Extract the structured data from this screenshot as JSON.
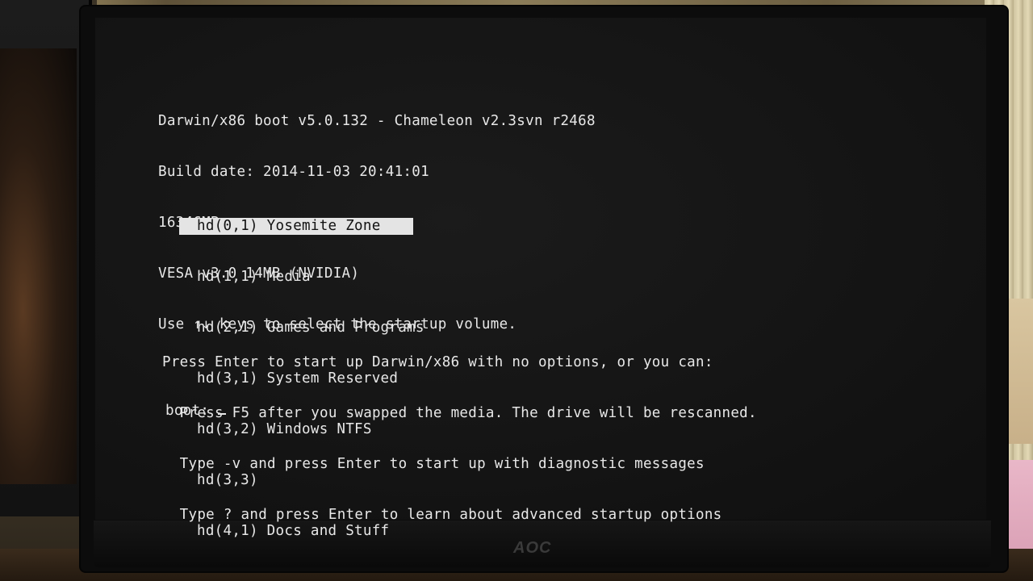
{
  "header": {
    "line1": "Darwin/x86 boot v5.0.132 - Chameleon v2.3svn r2468",
    "line2": "Build date: 2014-11-03 20:41:01",
    "line3": "16346MB memory",
    "line4": "VESA v3.0 14MB (NVIDIA)",
    "line5": "Use ↑↓ keys to select the startup volume."
  },
  "volumes": [
    {
      "label": "hd(0,1) Yosemite Zone",
      "selected": true
    },
    {
      "label": "hd(1,1) Media",
      "selected": false
    },
    {
      "label": "hd(2,1) Games and Programs",
      "selected": false
    },
    {
      "label": "hd(3,1) System Reserved",
      "selected": false
    },
    {
      "label": "hd(3,2) Windows NTFS",
      "selected": false
    },
    {
      "label": "hd(3,3)",
      "selected": false
    },
    {
      "label": "hd(4,1) Docs and Stuff",
      "selected": false
    }
  ],
  "help": {
    "line1": "Press Enter to start up Darwin/x86 with no options, or you can:",
    "line2": "  Press F5 after you swapped the media. The drive will be rescanned.",
    "line3": "  Type -v and press Enter to start up with diagnostic messages",
    "line4": "  Type ? and press Enter to learn about advanced startup options"
  },
  "prompt": {
    "label": "boot:",
    "value": ""
  },
  "monitor_brand": "AOC"
}
